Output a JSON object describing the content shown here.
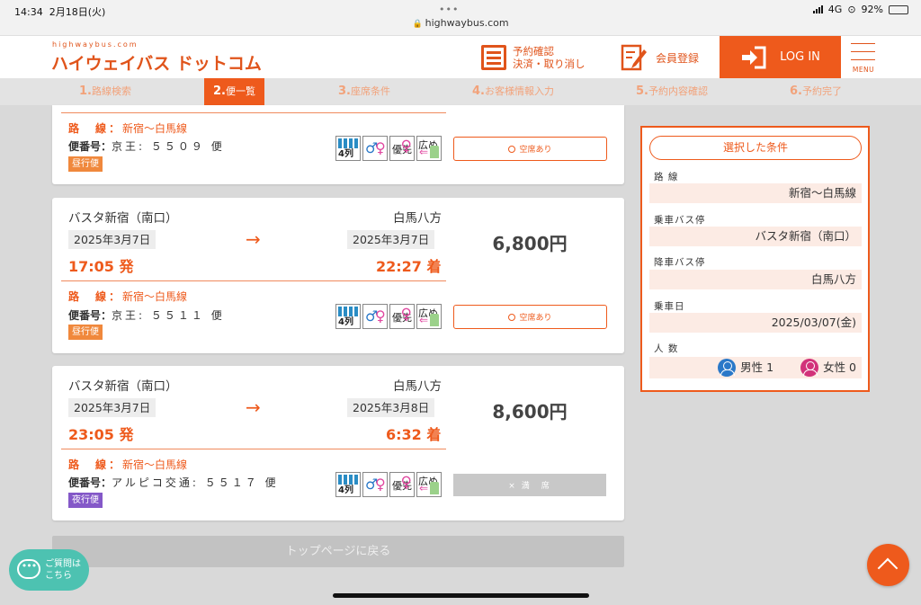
{
  "status": {
    "time": "14:34",
    "date": "2月18日(火)",
    "url": "highwaybus.com",
    "network": "4G",
    "battery": "92%"
  },
  "header": {
    "logo_small": "highwaybus.com",
    "logo_main": "ハイウェイバス ドットコム",
    "reserve_line1": "予約確認",
    "reserve_line2": "決済・取り消し",
    "member": "会員登録",
    "login": "LOG IN",
    "menu": "MENU"
  },
  "steps": [
    {
      "num": "1.",
      "label": "路線検索"
    },
    {
      "num": "2.",
      "label": "便一覧"
    },
    {
      "num": "3.",
      "label": "座席条件"
    },
    {
      "num": "4.",
      "label": "お客様情報入力"
    },
    {
      "num": "5.",
      "label": "予約内容確認"
    },
    {
      "num": "6.",
      "label": "予約完了"
    }
  ],
  "common": {
    "route_label": "路　線：",
    "bin_label": "便番号：",
    "arrow": "→",
    "icon_4retsu": "4列",
    "icon_yusen": "優先",
    "icon_hiro": "広め"
  },
  "cards": [
    {
      "route": "新宿〜白馬線",
      "bin": "京王: ５５０９ 便",
      "badge": "昼行便",
      "button": "空席あり"
    },
    {
      "from": "バスタ新宿（南口）",
      "to": "白馬八方",
      "dep_date": "2025年3月7日",
      "arr_date": "2025年3月7日",
      "dep_time": "17:05 発",
      "arr_time": "22:27 着",
      "price": "6,800円",
      "route": "新宿〜白馬線",
      "bin": "京王: ５５１１ 便",
      "badge": "昼行便",
      "button": "空席あり"
    },
    {
      "from": "バスタ新宿（南口）",
      "to": "白馬八方",
      "dep_date": "2025年3月7日",
      "arr_date": "2025年3月8日",
      "dep_time": "23:05 発",
      "arr_time": "6:32 着",
      "price": "8,600円",
      "route": "新宿〜白馬線",
      "bin": "アルピコ交通: ５５１７ 便",
      "badge": "夜行便",
      "button": "× 満　席"
    }
  ],
  "top_button": "トップページに戻る",
  "side": {
    "title": "選択した条件",
    "route_label": "路 線",
    "route": "新宿〜白馬線",
    "board_label": "乗車バス停",
    "board": "バスタ新宿（南口）",
    "alight_label": "降車バス停",
    "alight": "白馬八方",
    "date_label": "乗車日",
    "date": "2025/03/07(金)",
    "people_label": "人 数",
    "male": "男性 1",
    "female": "女性 0"
  },
  "chat": {
    "bubble": "•••",
    "line1": "ご質問は",
    "line2": "こちら"
  },
  "colors": {
    "accent": "#ee5a1c",
    "day_badge": "#f0883c",
    "night_badge": "#8458c8",
    "chat": "#4dc2b1"
  }
}
